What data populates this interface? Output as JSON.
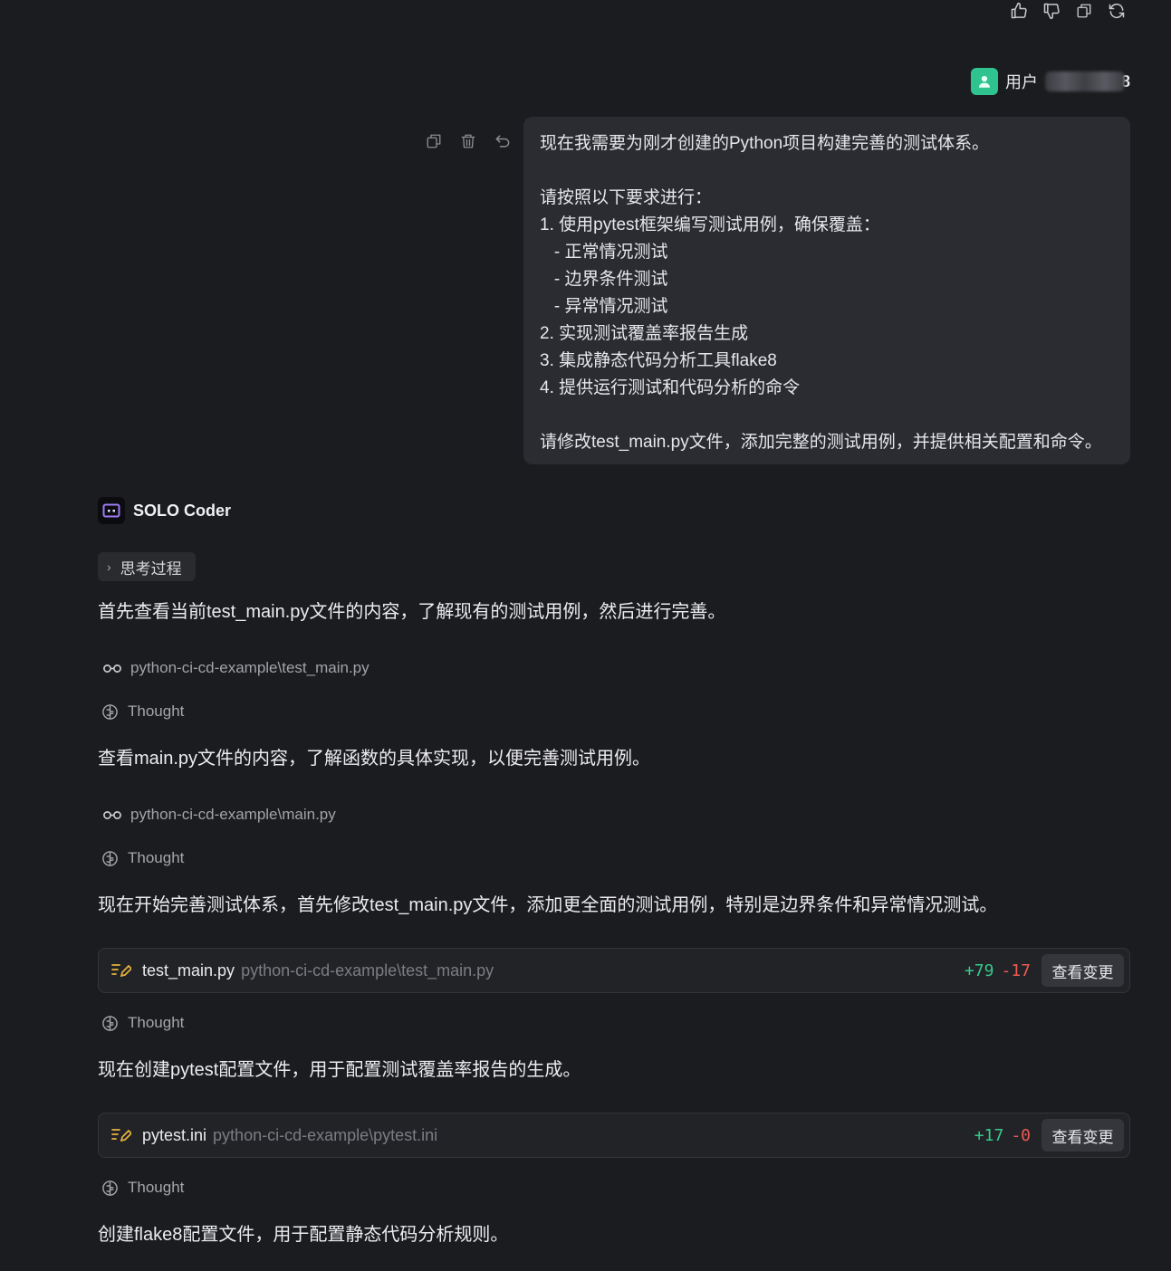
{
  "top_actions": {
    "icons": [
      "thumbs-up-icon",
      "thumbs-down-icon",
      "copy-icon",
      "refresh-icon"
    ]
  },
  "user": {
    "name": "用户",
    "suffix": "8",
    "avatar_color": "#2fc48f"
  },
  "message_actions": {
    "icons": [
      "copy-icon",
      "delete-icon",
      "undo-icon"
    ]
  },
  "user_message": {
    "lines": [
      "现在我需要为刚才创建的Python项目构建完善的测试体系。",
      "",
      "请按照以下要求进行：",
      "1. 使用pytest框架编写测试用例，确保覆盖：",
      "   - 正常情况测试",
      "   - 边界条件测试",
      "   - 异常情况测试",
      "2. 实现测试覆盖率报告生成",
      "3. 集成静态代码分析工具flake8",
      "4. 提供运行测试和代码分析的命令",
      "",
      "请修改test_main.py文件，添加完整的测试用例，并提供相关配置和命令。"
    ]
  },
  "agent": {
    "name": "SOLO Coder",
    "think_label": "思考过程"
  },
  "stream": {
    "p1": "首先查看当前test_main.py文件的内容，了解现有的测试用例，然后进行完善。",
    "file1": "python-ci-cd-example\\test_main.py",
    "thought_label": "Thought",
    "p2": "查看main.py文件的内容，了解函数的具体实现，以便完善测试用例。",
    "file2": "python-ci-cd-example\\main.py",
    "p3": "现在开始完善测试体系，首先修改test_main.py文件，添加更全面的测试用例，特别是边界条件和异常情况测试。",
    "p4": "现在创建pytest配置文件，用于配置测试覆盖率报告的生成。",
    "p5": "创建flake8配置文件，用于配置静态代码分析规则。"
  },
  "edits": [
    {
      "name": "test_main.py",
      "path": "python-ci-cd-example\\test_main.py",
      "added": "+79",
      "removed": "-17",
      "button": "查看变更"
    },
    {
      "name": "pytest.ini",
      "path": "python-ci-cd-example\\pytest.ini",
      "added": "+17",
      "removed": "-0",
      "button": "查看变更"
    }
  ],
  "colors": {
    "background": "#1b1c1f",
    "bubble": "#2b2c31",
    "added": "#38c98c",
    "removed": "#ee5a52",
    "agent_accent": "#9b7cf5"
  }
}
